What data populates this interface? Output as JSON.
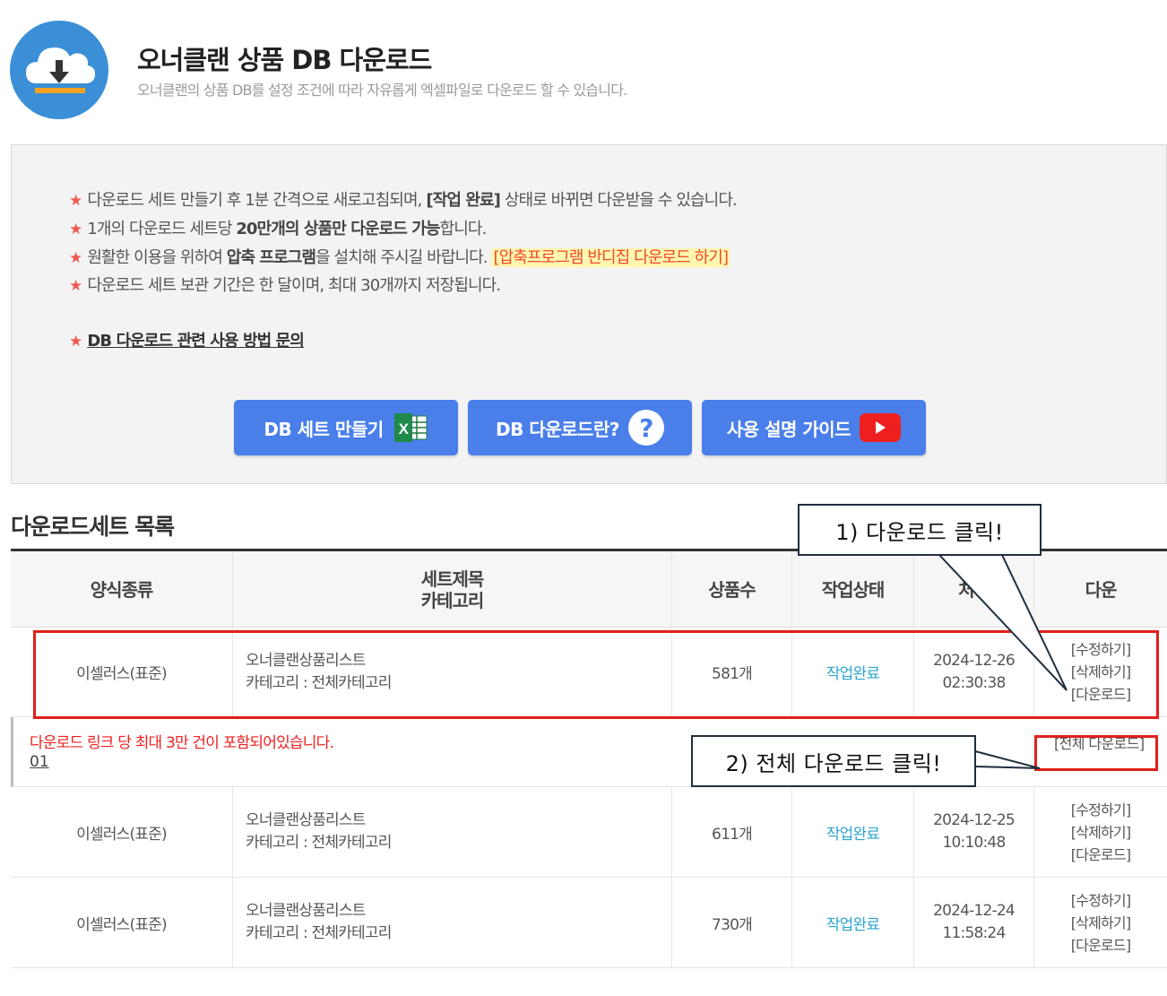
{
  "header": {
    "title": "오너클랜 상품 DB 다운로드",
    "subtitle": "오너클랜의 상품 DB를 설정 조건에 따라 자유롭게 엑셀파일로 다운로드 할 수 있습니다."
  },
  "notice": {
    "line1_a": "다운로드 세트 만들기 후 1분 간격으로 새로고침되며, ",
    "line1_b": "[작업 완료]",
    "line1_c": " 상태로 바뀌면 다운받을 수 있습니다.",
    "line2_a": "1개의 다운로드 세트당 ",
    "line2_b": "20만개의 상품만 다운로드 가능",
    "line2_c": "합니다.",
    "line3_a": "원활한 이용을 위하여 ",
    "line3_b": "압축 프로그램",
    "line3_c": "을 설치해 주시길 바랍니다. ",
    "line3_link": "[압축프로그램 반디집 다운로드 하기]",
    "line4": "다운로드 세트 보관 기간은 한 달이며, 최대 30개까지 저장됩니다.",
    "inquiry": "DB 다운로드 관련 사용 방법 문의",
    "star": "★"
  },
  "buttons": {
    "make_set": "DB 세트 만들기",
    "what_is": "DB 다운로드란?",
    "guide": "사용 설명 가이드",
    "qmark": "?"
  },
  "section_title": "다운로드세트 목록",
  "table": {
    "headers": {
      "form": "양식종류",
      "title_1": "세트제목",
      "title_2": "카테고리",
      "count": "상품수",
      "status": "작업상태",
      "processed": "처리",
      "download": "다운"
    },
    "rows": [
      {
        "form": "이셀러스(표준)",
        "title": "오너클랜상품리스트",
        "category": "카테고리 : 전체카테고리",
        "count": "581개",
        "status": "작업완료",
        "date": "2024-12-26",
        "time": "02:30:38",
        "edit": "[수정하기]",
        "delete": "[삭제하기]",
        "download": "[다운로드]"
      },
      {
        "form": "이셀러스(표준)",
        "title": "오너클랜상품리스트",
        "category": "카테고리 : 전체카테고리",
        "count": "611개",
        "status": "작업완료",
        "date": "2024-12-25",
        "time": "10:10:48",
        "edit": "[수정하기]",
        "delete": "[삭제하기]",
        "download": "[다운로드]"
      },
      {
        "form": "이셀러스(표준)",
        "title": "오너클랜상품리스트",
        "category": "카테고리 : 전체카테고리",
        "count": "730개",
        "status": "작업완료",
        "date": "2024-12-24",
        "time": "11:58:24",
        "edit": "[수정하기]",
        "delete": "[삭제하기]",
        "download": "[다운로드]"
      }
    ],
    "sub": {
      "warning": "다운로드 링크 당 최대 3만 건이 포함되어있습니다.",
      "link": "01",
      "all_download": "[전체 다운로드]"
    }
  },
  "annotations": {
    "step1": "1) 다운로드 클릭!",
    "step2": "2) 전체 다운로드 클릭!"
  },
  "colors": {
    "primary_button": "#4a7fea",
    "status_done": "#2aa5cf",
    "warning": "#f02020",
    "annotation": "#e0201a",
    "logo": "#3a8fd6"
  }
}
